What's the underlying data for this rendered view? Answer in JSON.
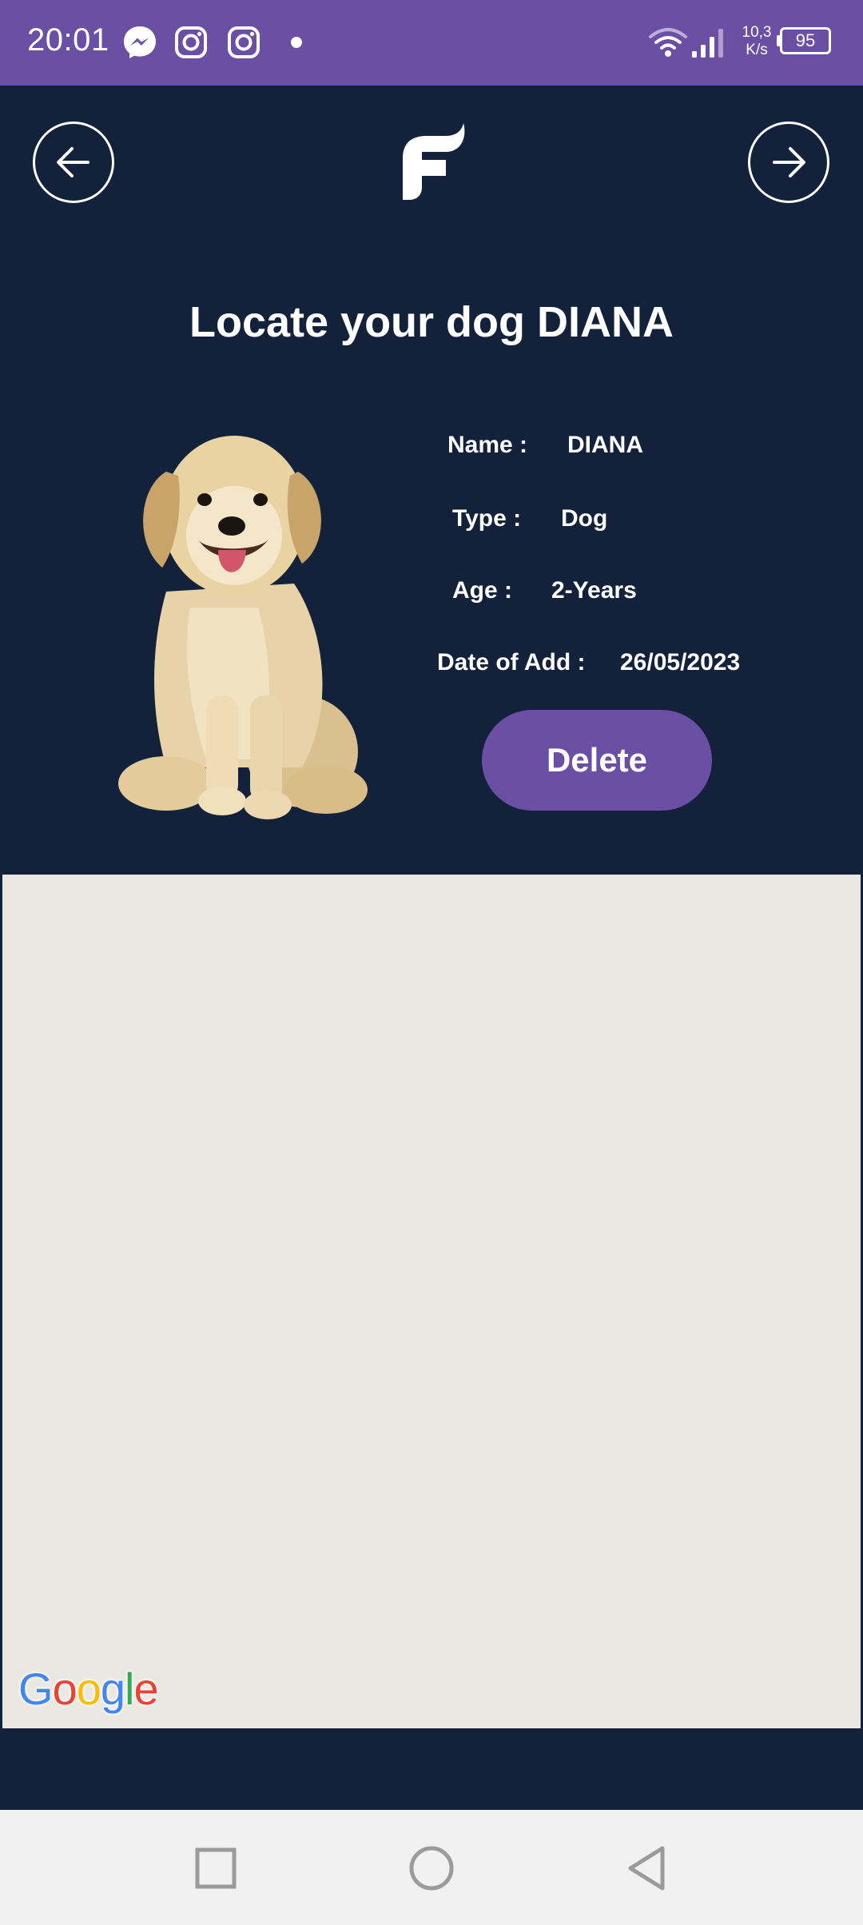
{
  "status_bar": {
    "time": "20:01",
    "icons": [
      "messenger-icon",
      "instagram-icon",
      "instagram-icon",
      "notification-dot"
    ],
    "net_speed_value": "10,3",
    "net_speed_unit": "K/s",
    "battery": "95"
  },
  "header": {
    "back_icon": "arrow-left-icon",
    "forward_icon": "arrow-right-icon",
    "logo_icon": "app-logo-icon"
  },
  "page": {
    "title": "Locate your dog DIANA"
  },
  "pet": {
    "name_label": "Name :",
    "name_value": "DIANA",
    "type_label": "Type :",
    "type_value": "Dog",
    "age_label": "Age :",
    "age_value": "2-Years",
    "date_label": "Date of Add :",
    "date_value": "26/05/2023"
  },
  "actions": {
    "delete_label": "Delete"
  },
  "map": {
    "attribution": "Google"
  },
  "colors": {
    "primary": "#6a4fa5",
    "background": "#13223a",
    "map_background": "#ebe8e2",
    "nav_bar": "#f1f1f1"
  },
  "nav": {
    "recent_icon": "square-icon",
    "home_icon": "circle-icon",
    "back_icon": "triangle-back-icon"
  }
}
